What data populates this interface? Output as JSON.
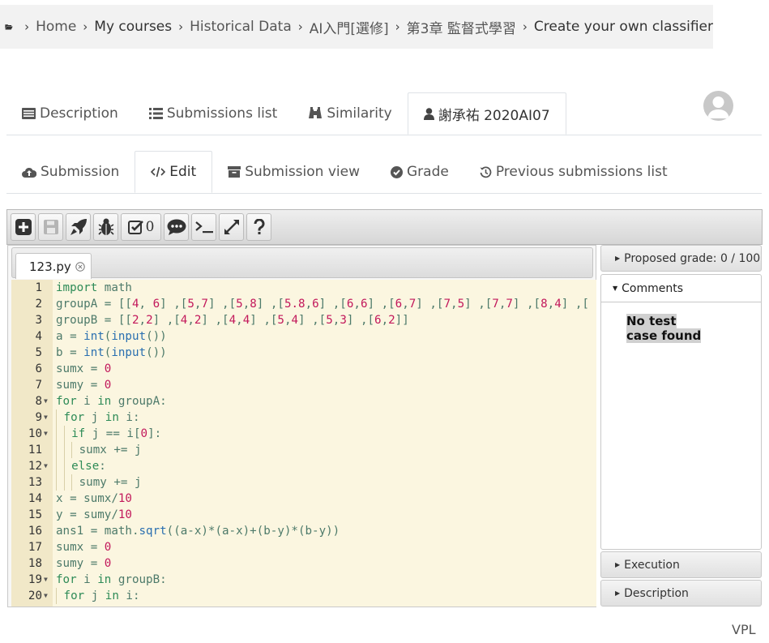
{
  "breadcrumb": {
    "items": [
      "Home",
      "My courses",
      "Historical Data",
      "AI入門[選修]",
      "第3章 監督式學習",
      "Create your own classifier"
    ]
  },
  "tabs_top": [
    {
      "label": "Description",
      "icon": "list-alt-icon"
    },
    {
      "label": "Submissions list",
      "icon": "list-icon"
    },
    {
      "label": "Similarity",
      "icon": "binoculars-icon"
    },
    {
      "label": "謝承祐 2020AI07",
      "icon": "user-icon",
      "active": true
    }
  ],
  "tabs_sub": [
    {
      "label": "Submission",
      "icon": "cloud-upload-icon"
    },
    {
      "label": "Edit",
      "icon": "code-icon",
      "active": true
    },
    {
      "label": "Submission view",
      "icon": "archive-icon"
    },
    {
      "label": "Grade",
      "icon": "check-circle-icon"
    },
    {
      "label": "Previous submissions list",
      "icon": "history-icon"
    }
  ],
  "toolbar": {
    "check_count": "0"
  },
  "editor": {
    "file_tab": "123.py",
    "lines": [
      "import math",
      "groupA = [[4, 6] ,[5,7] ,[5,8] ,[5.8,6] ,[6,6] ,[6,7] ,[7,5] ,[7,7] ,[8,4] ,[",
      "groupB = [[2,2] ,[4,2] ,[4,4] ,[5,4] ,[5,3] ,[6,2]]",
      "a = int(input())",
      "b = int(input())",
      "sumx = 0",
      "sumy = 0",
      "for i in groupA:",
      "  for j in i:",
      "    if j == i[0]:",
      "      sumx += j",
      "    else:",
      "      sumy += j",
      "x = sumx/10",
      "y = sumy/10",
      "ans1 = math.sqrt((a-x)*(a-x)+(b-y)*(b-y))",
      "sumx = 0",
      "sumy = 0",
      "for i in groupB:",
      "  for j in i:"
    ],
    "folds": [
      8,
      9,
      10,
      12,
      19,
      20
    ]
  },
  "right_panel": {
    "proposed_grade": "Proposed grade: 0 / 100",
    "comments": "Comments",
    "no_test": "No test case found",
    "execution": "Execution",
    "description": "Description"
  },
  "footer": "VPL"
}
